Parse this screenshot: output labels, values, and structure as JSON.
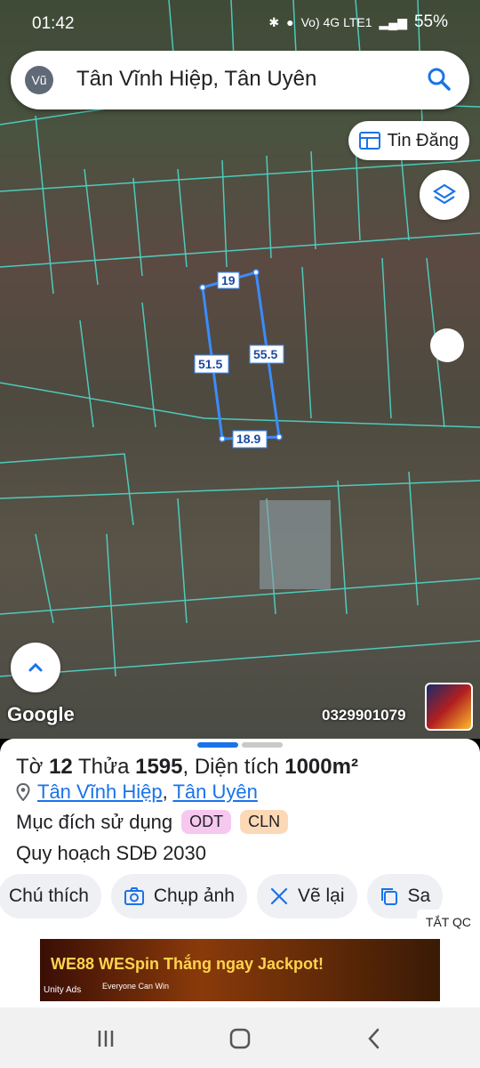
{
  "status": {
    "time": "01:42",
    "network": "Vo) 4G LTE1",
    "battery": "55%"
  },
  "search": {
    "avatar": "Vũ",
    "query": "Tân Vĩnh Hiệp, Tân Uyên"
  },
  "buttons": {
    "tin_dang": "Tin Đăng"
  },
  "map": {
    "measures": [
      "19",
      "51.5",
      "55.5",
      "18.9"
    ],
    "brand": "Google",
    "phone": "0329901079"
  },
  "parcel": {
    "to_label": "Tờ",
    "to_value": "12",
    "thua_label": "Thửa",
    "thua_value": "1595",
    "area_label": ", Diện tích",
    "area_value": "1000m²",
    "ward": "Tân Vĩnh Hiệp",
    "district": "Tân Uyên",
    "loc_sep": ", ",
    "purpose_label": "Mục đích sử dụng",
    "badges": [
      "ODT",
      "CLN"
    ],
    "plan": "Quy hoạch SDĐ 2030"
  },
  "actions": [
    "Chú thích",
    "Chụp ảnh",
    "Vẽ lại",
    "Sa"
  ],
  "ad": {
    "close": "TẮT QC",
    "text": "WE88 WESpin Thắng ngay Jackpot!",
    "sub": "Everyone Can Win",
    "network": "Unity Ads"
  },
  "colors": {
    "accent": "#1a73e8",
    "badge_odt": "#f6c8f0",
    "badge_cln": "#fcd9b6",
    "parcel_line": "#3b8cff",
    "grid_line": "#4ee0d0",
    "handle_active": "#1a73e8",
    "handle_inactive": "#c9c9c9"
  }
}
